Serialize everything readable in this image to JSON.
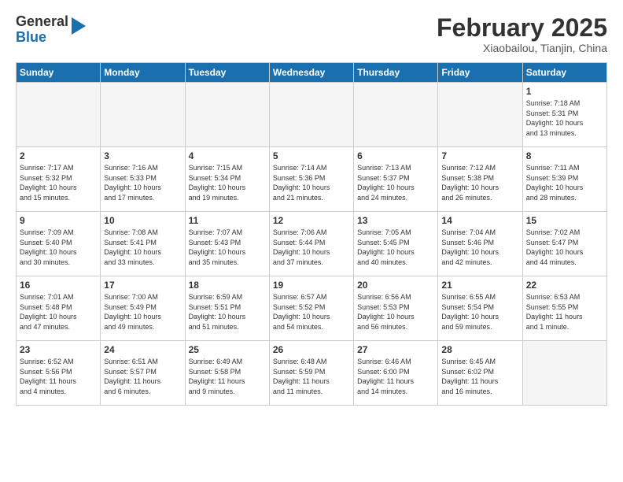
{
  "header": {
    "logo_general": "General",
    "logo_blue": "Blue",
    "month_title": "February 2025",
    "subtitle": "Xiaobailou, Tianjin, China"
  },
  "days_of_week": [
    "Sunday",
    "Monday",
    "Tuesday",
    "Wednesday",
    "Thursday",
    "Friday",
    "Saturday"
  ],
  "weeks": [
    [
      {
        "day": "",
        "info": ""
      },
      {
        "day": "",
        "info": ""
      },
      {
        "day": "",
        "info": ""
      },
      {
        "day": "",
        "info": ""
      },
      {
        "day": "",
        "info": ""
      },
      {
        "day": "",
        "info": ""
      },
      {
        "day": "1",
        "info": "Sunrise: 7:18 AM\nSunset: 5:31 PM\nDaylight: 10 hours\nand 13 minutes."
      }
    ],
    [
      {
        "day": "2",
        "info": "Sunrise: 7:17 AM\nSunset: 5:32 PM\nDaylight: 10 hours\nand 15 minutes."
      },
      {
        "day": "3",
        "info": "Sunrise: 7:16 AM\nSunset: 5:33 PM\nDaylight: 10 hours\nand 17 minutes."
      },
      {
        "day": "4",
        "info": "Sunrise: 7:15 AM\nSunset: 5:34 PM\nDaylight: 10 hours\nand 19 minutes."
      },
      {
        "day": "5",
        "info": "Sunrise: 7:14 AM\nSunset: 5:36 PM\nDaylight: 10 hours\nand 21 minutes."
      },
      {
        "day": "6",
        "info": "Sunrise: 7:13 AM\nSunset: 5:37 PM\nDaylight: 10 hours\nand 24 minutes."
      },
      {
        "day": "7",
        "info": "Sunrise: 7:12 AM\nSunset: 5:38 PM\nDaylight: 10 hours\nand 26 minutes."
      },
      {
        "day": "8",
        "info": "Sunrise: 7:11 AM\nSunset: 5:39 PM\nDaylight: 10 hours\nand 28 minutes."
      }
    ],
    [
      {
        "day": "9",
        "info": "Sunrise: 7:09 AM\nSunset: 5:40 PM\nDaylight: 10 hours\nand 30 minutes."
      },
      {
        "day": "10",
        "info": "Sunrise: 7:08 AM\nSunset: 5:41 PM\nDaylight: 10 hours\nand 33 minutes."
      },
      {
        "day": "11",
        "info": "Sunrise: 7:07 AM\nSunset: 5:43 PM\nDaylight: 10 hours\nand 35 minutes."
      },
      {
        "day": "12",
        "info": "Sunrise: 7:06 AM\nSunset: 5:44 PM\nDaylight: 10 hours\nand 37 minutes."
      },
      {
        "day": "13",
        "info": "Sunrise: 7:05 AM\nSunset: 5:45 PM\nDaylight: 10 hours\nand 40 minutes."
      },
      {
        "day": "14",
        "info": "Sunrise: 7:04 AM\nSunset: 5:46 PM\nDaylight: 10 hours\nand 42 minutes."
      },
      {
        "day": "15",
        "info": "Sunrise: 7:02 AM\nSunset: 5:47 PM\nDaylight: 10 hours\nand 44 minutes."
      }
    ],
    [
      {
        "day": "16",
        "info": "Sunrise: 7:01 AM\nSunset: 5:48 PM\nDaylight: 10 hours\nand 47 minutes."
      },
      {
        "day": "17",
        "info": "Sunrise: 7:00 AM\nSunset: 5:49 PM\nDaylight: 10 hours\nand 49 minutes."
      },
      {
        "day": "18",
        "info": "Sunrise: 6:59 AM\nSunset: 5:51 PM\nDaylight: 10 hours\nand 51 minutes."
      },
      {
        "day": "19",
        "info": "Sunrise: 6:57 AM\nSunset: 5:52 PM\nDaylight: 10 hours\nand 54 minutes."
      },
      {
        "day": "20",
        "info": "Sunrise: 6:56 AM\nSunset: 5:53 PM\nDaylight: 10 hours\nand 56 minutes."
      },
      {
        "day": "21",
        "info": "Sunrise: 6:55 AM\nSunset: 5:54 PM\nDaylight: 10 hours\nand 59 minutes."
      },
      {
        "day": "22",
        "info": "Sunrise: 6:53 AM\nSunset: 5:55 PM\nDaylight: 11 hours\nand 1 minute."
      }
    ],
    [
      {
        "day": "23",
        "info": "Sunrise: 6:52 AM\nSunset: 5:56 PM\nDaylight: 11 hours\nand 4 minutes."
      },
      {
        "day": "24",
        "info": "Sunrise: 6:51 AM\nSunset: 5:57 PM\nDaylight: 11 hours\nand 6 minutes."
      },
      {
        "day": "25",
        "info": "Sunrise: 6:49 AM\nSunset: 5:58 PM\nDaylight: 11 hours\nand 9 minutes."
      },
      {
        "day": "26",
        "info": "Sunrise: 6:48 AM\nSunset: 5:59 PM\nDaylight: 11 hours\nand 11 minutes."
      },
      {
        "day": "27",
        "info": "Sunrise: 6:46 AM\nSunset: 6:00 PM\nDaylight: 11 hours\nand 14 minutes."
      },
      {
        "day": "28",
        "info": "Sunrise: 6:45 AM\nSunset: 6:02 PM\nDaylight: 11 hours\nand 16 minutes."
      },
      {
        "day": "",
        "info": ""
      }
    ]
  ]
}
